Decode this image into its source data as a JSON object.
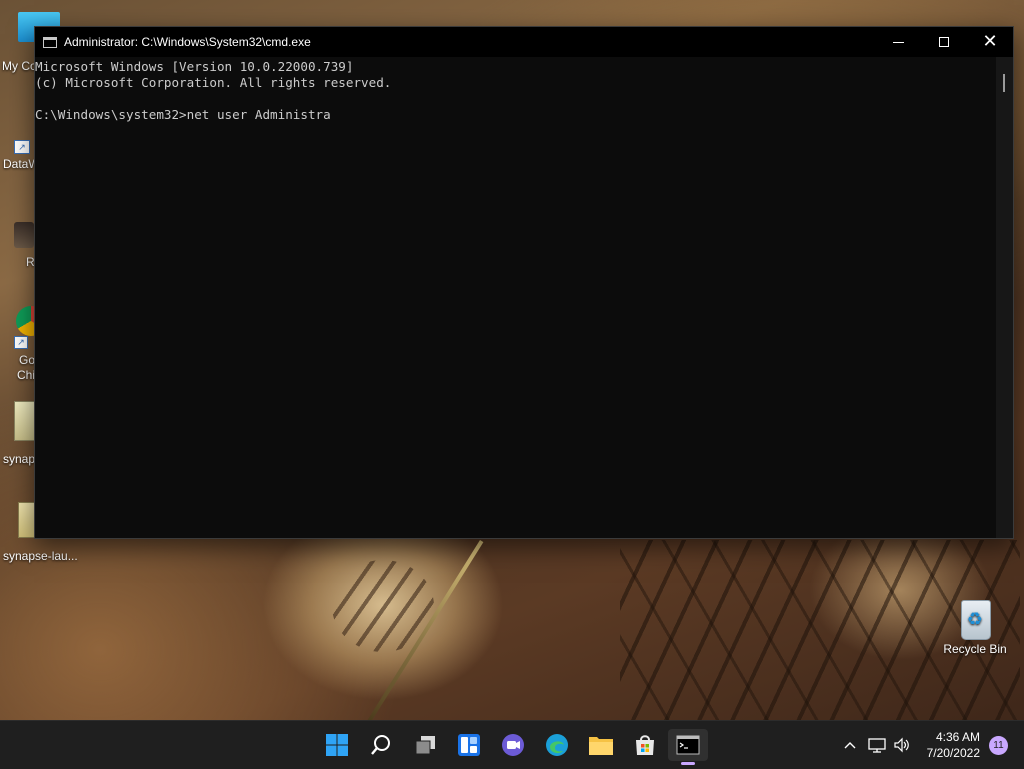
{
  "desktop": {
    "icons_left": [
      {
        "label": "My Co"
      },
      {
        "label": "DataW"
      },
      {
        "label": "R"
      },
      {
        "label": "Go"
      },
      {
        "label": "Chi"
      },
      {
        "label": "synap"
      },
      {
        "label": "synapse-lau..."
      }
    ],
    "recycle_bin": {
      "label": "Recycle Bin"
    }
  },
  "window": {
    "title": "Administrator: C:\\Windows\\System32\\cmd.exe",
    "console_lines": [
      "Microsoft Windows [Version 10.0.22000.739]",
      "(c) Microsoft Corporation. All rights reserved.",
      "",
      "C:\\Windows\\system32>net user Administra"
    ]
  },
  "taskbar": {
    "icons": [
      "start-icon",
      "search-icon",
      "task-view-icon",
      "widgets-icon",
      "chat-icon",
      "edge-icon",
      "file-explorer-icon",
      "store-icon",
      "cmd-icon"
    ],
    "clock": {
      "time": "4:36 AM",
      "date": "7/20/2022"
    },
    "notifications": "11"
  },
  "colors": {
    "console_bg": "#0c0c0c",
    "console_text": "#cccccc",
    "taskbar_bg": "#1f1f1f",
    "accent": "#c9a8ff"
  }
}
